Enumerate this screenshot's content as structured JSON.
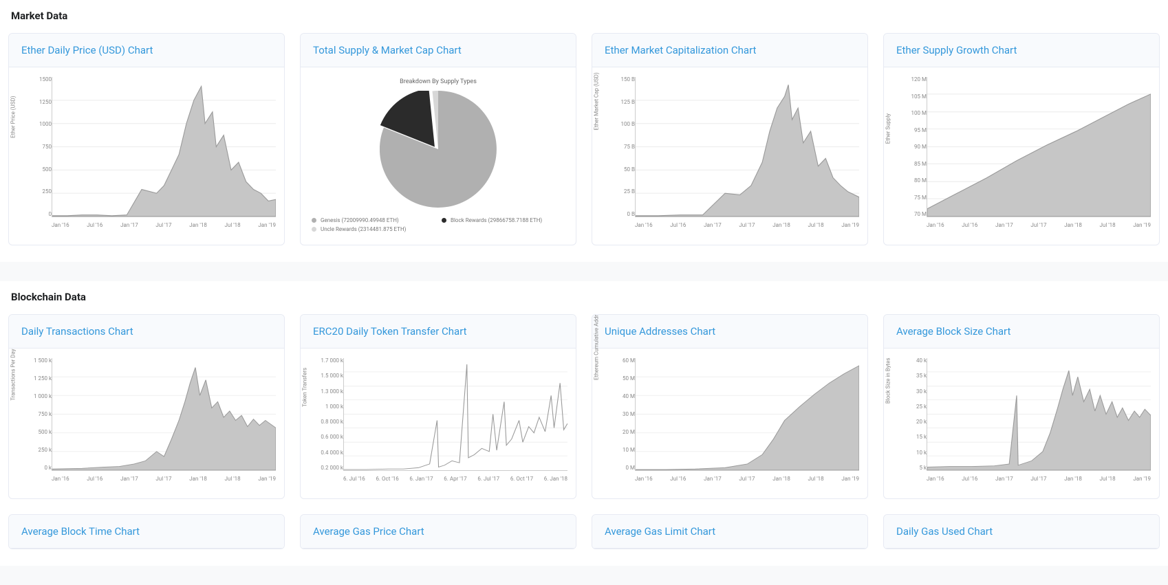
{
  "sections": {
    "market": {
      "title": "Market Data"
    },
    "blockchain": {
      "title": "Blockchain Data"
    }
  },
  "cards": {
    "price": {
      "title": "Ether Daily Price (USD) Chart",
      "ylabel": "Ether Price (USD)"
    },
    "supply": {
      "title": "Total Supply & Market Cap Chart",
      "pie_title": "Breakdown By Supply Types"
    },
    "marketcap": {
      "title": "Ether Market Capitalization Chart",
      "ylabel": "Ether Market Cap (USD)"
    },
    "growth": {
      "title": "Ether Supply Growth Chart",
      "ylabel": "Ether Supply"
    },
    "tx": {
      "title": "Daily Transactions Chart",
      "ylabel": "Transactions Per Day"
    },
    "erc20": {
      "title": "ERC20 Daily Token Transfer Chart",
      "ylabel": "Token Transfers"
    },
    "addresses": {
      "title": "Unique Addresses Chart",
      "ylabel": "Ethereum Cumulative Address Growth"
    },
    "blocksize": {
      "title": "Average Block Size Chart",
      "ylabel": "Block Size in Bytes"
    },
    "blocktime": {
      "title": "Average Block Time Chart"
    },
    "gasprice": {
      "title": "Average Gas Price Chart"
    },
    "gaslimit": {
      "title": "Average Gas Limit Chart"
    },
    "gasused": {
      "title": "Daily Gas Used Chart"
    }
  },
  "x_ticks_std": [
    "Jan '16",
    "Jul '16",
    "Jan '17",
    "Jul '17",
    "Jan '18",
    "Jul '18",
    "Jan '19"
  ],
  "x_ticks_erc": [
    "6. Jul '16",
    "6. Oct '16",
    "6. Jan '17",
    "6. Apr '17",
    "6. Jul '17",
    "6. Oct '17",
    "6. Jan '18"
  ],
  "y_ticks": {
    "price": [
      "1500",
      "1250",
      "1000",
      "750",
      "500",
      "250",
      "0"
    ],
    "marketcap": [
      "150 B",
      "125 B",
      "100 B",
      "75 B",
      "50 B",
      "25 B",
      "0 B"
    ],
    "growth": [
      "120 M",
      "105 M",
      "100 M",
      "95 M",
      "90 M",
      "85 M",
      "80 M",
      "75 M",
      "70 M"
    ],
    "tx": [
      "1 500 k",
      "1 250 k",
      "1 000 k",
      "750 k",
      "500 k",
      "250 k",
      "0 k"
    ],
    "erc20": [
      "1.7 000 k",
      "1.5 000 k",
      "1.3 000 k",
      "1 000 k",
      "0.8 000 k",
      "0.6 000 k",
      "0.4 000 k",
      "0.2 000 k"
    ],
    "addresses": [
      "60 M",
      "50 M",
      "40 M",
      "30 M",
      "20 M",
      "10 M",
      "0 M"
    ],
    "blocksize": [
      "40 k",
      "35 k",
      "30 k",
      "25 k",
      "20 k",
      "15 k",
      "10 k",
      "5 k"
    ]
  },
  "pie_legend": {
    "genesis": {
      "label": "Genesis (72009990.49948 ETH)",
      "color": "#b0b0b0"
    },
    "block": {
      "label": "Block Rewards (29866758.7188 ETH)",
      "color": "#2b2b2b"
    },
    "uncle": {
      "label": "Uncle Rewards (2314481.875 ETH)",
      "color": "#d7d7d7"
    }
  },
  "chart_data": [
    {
      "id": "price",
      "type": "area",
      "title": "Ether Daily Price (USD) Chart",
      "xlabel": "",
      "ylabel": "Ether Price (USD)",
      "ylim": [
        0,
        1500
      ],
      "x": [
        "Jan '16",
        "Jul '16",
        "Jan '17",
        "Jul '17",
        "Jan '18",
        "Jul '18",
        "Jan '19"
      ],
      "values": [
        1,
        12,
        8,
        300,
        1400,
        450,
        150
      ]
    },
    {
      "id": "supply",
      "type": "pie",
      "title": "Breakdown By Supply Types",
      "series": [
        {
          "name": "Genesis",
          "value": 72009990.49948
        },
        {
          "name": "Block Rewards",
          "value": 29866758.7188
        },
        {
          "name": "Uncle Rewards",
          "value": 2314481.875
        }
      ]
    },
    {
      "id": "marketcap",
      "type": "area",
      "title": "Ether Market Capitalization Chart",
      "xlabel": "",
      "ylabel": "Ether Market Cap (USD)",
      "ylim": [
        0,
        150000000000
      ],
      "x": [
        "Jan '16",
        "Jul '16",
        "Jan '17",
        "Jul '17",
        "Jan '18",
        "Jul '18",
        "Jan '19"
      ],
      "values": [
        80000000,
        1000000000,
        700000000,
        28000000000,
        133000000000,
        45000000000,
        16000000000
      ]
    },
    {
      "id": "growth",
      "type": "area",
      "title": "Ether Supply Growth Chart",
      "xlabel": "",
      "ylabel": "Ether Supply",
      "ylim": [
        70000000,
        120000000
      ],
      "x": [
        "Jan '16",
        "Jul '16",
        "Jan '17",
        "Jul '17",
        "Jan '18",
        "Jul '18",
        "Jan '19"
      ],
      "values": [
        76000000,
        82000000,
        88000000,
        93000000,
        97000000,
        101000000,
        104500000
      ]
    },
    {
      "id": "tx",
      "type": "area",
      "title": "Daily Transactions Chart",
      "xlabel": "",
      "ylabel": "Transactions Per Day",
      "ylim": [
        0,
        1500000
      ],
      "x": [
        "Jan '16",
        "Jul '16",
        "Jan '17",
        "Jul '17",
        "Jan '18",
        "Jul '18",
        "Jan '19"
      ],
      "values": [
        20000,
        45000,
        45000,
        300000,
        1350000,
        750000,
        580000
      ]
    },
    {
      "id": "erc20",
      "type": "line",
      "title": "ERC20 Daily Token Transfer Chart",
      "xlabel": "",
      "ylabel": "Token Transfers",
      "ylim": [
        0,
        1700000
      ],
      "x": [
        "6. Jul '16",
        "6. Oct '16",
        "6. Jan '17",
        "6. Apr '17",
        "6. Jul '17",
        "6. Oct '17",
        "6. Jan '18"
      ],
      "values": [
        1000,
        5000,
        20000,
        80000,
        250000,
        500000,
        700000
      ]
    },
    {
      "id": "addresses",
      "type": "area",
      "title": "Unique Addresses Chart",
      "xlabel": "",
      "ylabel": "Ethereum Cumulative Address Growth",
      "ylim": [
        0,
        60000000
      ],
      "x": [
        "Jan '16",
        "Jul '16",
        "Jan '17",
        "Jul '17",
        "Jan '18",
        "Jul '18",
        "Jan '19"
      ],
      "values": [
        200000,
        700000,
        1200000,
        4000000,
        24000000,
        42000000,
        55000000
      ]
    },
    {
      "id": "blocksize",
      "type": "area",
      "title": "Average Block Size Chart",
      "xlabel": "",
      "ylabel": "Block Size in Bytes",
      "ylim": [
        0,
        40000
      ],
      "x": [
        "Jan '16",
        "Jul '16",
        "Jan '17",
        "Jul '17",
        "Jan '18",
        "Jul '18",
        "Jan '19"
      ],
      "values": [
        1500,
        2000,
        2500,
        8000,
        28000,
        22000,
        20000
      ]
    }
  ]
}
